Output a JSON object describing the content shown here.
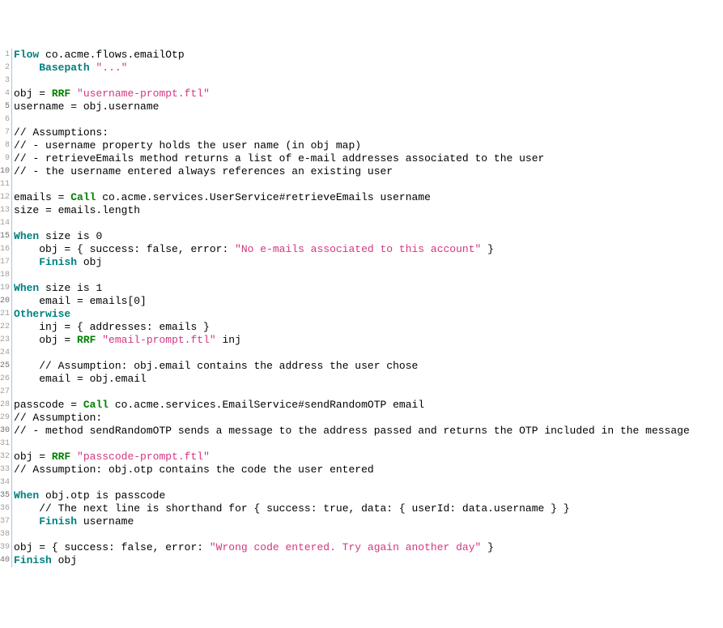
{
  "code": {
    "lines": [
      [
        [
          "kw",
          "Flow"
        ],
        [
          "txt",
          " co.acme.flows.emailOtp"
        ]
      ],
      [
        [
          "txt",
          "    "
        ],
        [
          "kw",
          "Basepath"
        ],
        [
          "txt",
          " "
        ],
        [
          "str",
          "\"...\""
        ]
      ],
      [],
      [
        [
          "txt",
          "obj = "
        ],
        [
          "fn",
          "RRF"
        ],
        [
          "txt",
          " "
        ],
        [
          "str",
          "\"username-prompt.ftl\""
        ]
      ],
      [
        [
          "txt",
          "username = obj.username"
        ]
      ],
      [],
      [
        [
          "cmt",
          "// Assumptions:"
        ]
      ],
      [
        [
          "cmt",
          "// - username property holds the user name (in obj map)"
        ]
      ],
      [
        [
          "cmt",
          "// - retrieveEmails method returns a list of e-mail addresses associated to the user"
        ]
      ],
      [
        [
          "cmt",
          "// - the username entered always references an existing user"
        ]
      ],
      [],
      [
        [
          "txt",
          "emails = "
        ],
        [
          "fn",
          "Call"
        ],
        [
          "txt",
          " co.acme.services.UserService#retrieveEmails username"
        ]
      ],
      [
        [
          "txt",
          "size = emails.length"
        ]
      ],
      [],
      [
        [
          "kw",
          "When"
        ],
        [
          "txt",
          " size is 0"
        ]
      ],
      [
        [
          "txt",
          "    obj = { success: false, error: "
        ],
        [
          "str",
          "\"No e-mails associated to this account\""
        ],
        [
          "txt",
          " }"
        ]
      ],
      [
        [
          "txt",
          "    "
        ],
        [
          "kw",
          "Finish"
        ],
        [
          "txt",
          " obj"
        ]
      ],
      [],
      [
        [
          "kw",
          "When"
        ],
        [
          "txt",
          " size is 1"
        ]
      ],
      [
        [
          "txt",
          "    email = emails[0]"
        ]
      ],
      [
        [
          "kw",
          "Otherwise"
        ]
      ],
      [
        [
          "txt",
          "    inj = { addresses: emails }"
        ]
      ],
      [
        [
          "txt",
          "    obj = "
        ],
        [
          "fn",
          "RRF"
        ],
        [
          "txt",
          " "
        ],
        [
          "str",
          "\"email-prompt.ftl\""
        ],
        [
          "txt",
          " inj"
        ]
      ],
      [],
      [
        [
          "txt",
          "    "
        ],
        [
          "cmt",
          "// Assumption: obj.email contains the address the user chose"
        ]
      ],
      [
        [
          "txt",
          "    email = obj.email"
        ]
      ],
      [],
      [
        [
          "txt",
          "passcode = "
        ],
        [
          "fn",
          "Call"
        ],
        [
          "txt",
          " co.acme.services.EmailService#sendRandomOTP email"
        ]
      ],
      [
        [
          "cmt",
          "// Assumption:"
        ]
      ],
      [
        [
          "cmt",
          "// - method sendRandomOTP sends a message to the address passed and returns the OTP included in the message"
        ]
      ],
      [],
      [
        [
          "txt",
          "obj = "
        ],
        [
          "fn",
          "RRF"
        ],
        [
          "txt",
          " "
        ],
        [
          "str",
          "\"passcode-prompt.ftl\""
        ]
      ],
      [
        [
          "cmt",
          "// Assumption: obj.otp contains the code the user entered"
        ]
      ],
      [],
      [
        [
          "kw",
          "When"
        ],
        [
          "txt",
          " obj.otp is passcode"
        ]
      ],
      [
        [
          "txt",
          "    "
        ],
        [
          "cmt",
          "// The next line is shorthand for { success: true, data: { userId: data.username } }"
        ]
      ],
      [
        [
          "txt",
          "    "
        ],
        [
          "kw",
          "Finish"
        ],
        [
          "txt",
          " username"
        ]
      ],
      [],
      [
        [
          "txt",
          "obj = { success: false, error: "
        ],
        [
          "str",
          "\"Wrong code entered. Try again another day\""
        ],
        [
          "txt",
          " }"
        ]
      ],
      [
        [
          "kw",
          "Finish"
        ],
        [
          "txt",
          " obj"
        ]
      ]
    ]
  }
}
